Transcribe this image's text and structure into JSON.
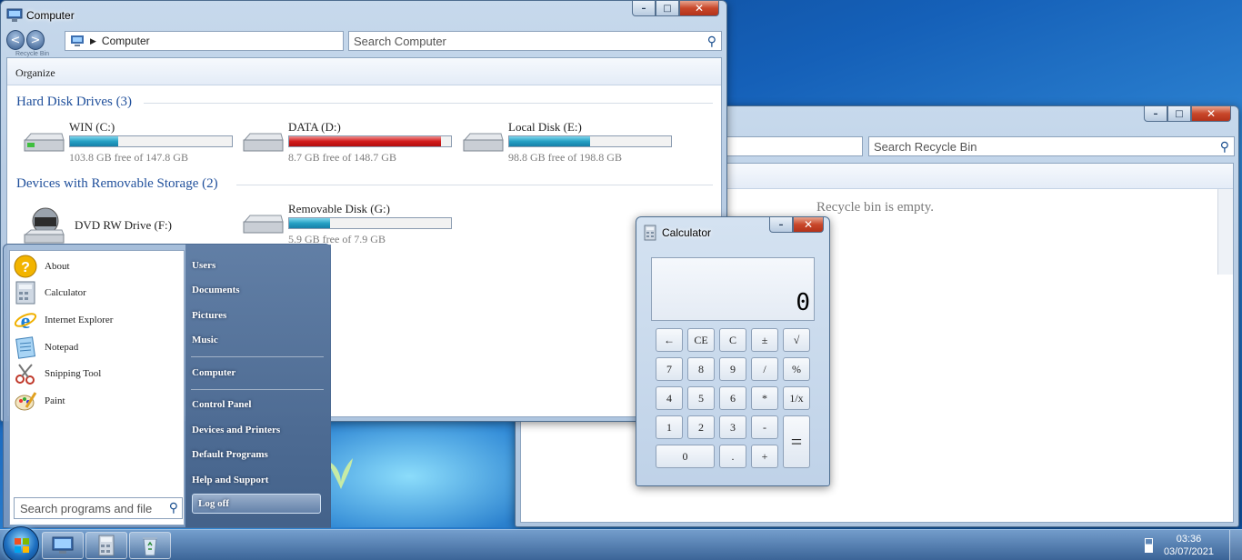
{
  "explorer": {
    "title": "Computer",
    "address": "Computer",
    "address_sub": "Recycle Bin",
    "search_placeholder": "Search Computer",
    "toolbar": {
      "organize": "Organize"
    },
    "groups": [
      {
        "title": "Hard Disk Drives (3)",
        "drives": [
          {
            "name": "WIN (C:)",
            "free": "103.8 GB free of 147.8 GB",
            "used_fraction": 0.3,
            "color": "#26a0c4"
          },
          {
            "name": "DATA (D:)",
            "free": "8.7 GB free of 148.7 GB",
            "used_fraction": 0.94,
            "color": "#d21c1c"
          },
          {
            "name": "Local Disk (E:)",
            "free": "98.8 GB free of 198.8 GB",
            "used_fraction": 0.5,
            "color": "#26a0c4"
          }
        ]
      },
      {
        "title": "Devices with Removable Storage (2)",
        "drives": [
          {
            "name": "DVD RW Drive (F:)"
          },
          {
            "name": "Removable Disk (G:)",
            "free": "5.9 GB free of 7.9 GB",
            "used_fraction": 0.25,
            "color": "#26a0c4"
          }
        ]
      }
    ]
  },
  "recycle": {
    "search_placeholder": "Search Recycle Bin",
    "empty_message": "Recycle bin is empty."
  },
  "calculator": {
    "title": "Calculator",
    "display": "0",
    "keys": [
      "←",
      "CE",
      "C",
      "±",
      "√",
      "7",
      "8",
      "9",
      "/",
      "%",
      "4",
      "5",
      "6",
      "*",
      "1/x",
      "1",
      "2",
      "3",
      "-",
      "=",
      "0",
      ".",
      "+"
    ]
  },
  "start_menu": {
    "programs": [
      "About",
      "Calculator",
      "Internet Explorer",
      "Notepad",
      "Snipping Tool",
      "Paint"
    ],
    "search_placeholder": "Search programs and file",
    "links": [
      "Users",
      "Documents",
      "Pictures",
      "Music",
      "Computer",
      "Control Panel",
      "Devices and Printers",
      "Default Programs",
      "Help and Support"
    ],
    "logoff": "Log off"
  },
  "taskbar": {
    "time": "03:36",
    "date": "03/07/2021"
  }
}
